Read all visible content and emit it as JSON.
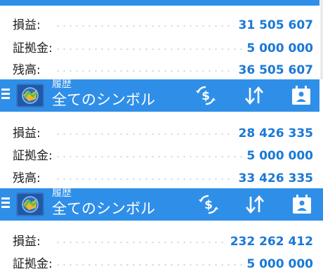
{
  "colors": {
    "toolbar": "#2f8fe8",
    "value": "#1a78d6",
    "label": "#1e1e1e"
  },
  "block1": {
    "rows": [
      {
        "label": "損益:",
        "value": "31 505 607"
      },
      {
        "label": "証拠金:",
        "value": "5 000 000"
      },
      {
        "label": "残高:",
        "value": "36 505 607"
      }
    ]
  },
  "toolbar1": {
    "subtitle": "履歴",
    "title": "全てのシンボル",
    "icons": [
      "menu-icon",
      "app-logo-icon",
      "currency-exchange-icon",
      "sort-icon",
      "calendar-icon"
    ]
  },
  "block2": {
    "rows": [
      {
        "label": "損益:",
        "value": "28 426 335"
      },
      {
        "label": "証拠金:",
        "value": "5 000 000"
      },
      {
        "label": "残高:",
        "value": "33 426 335"
      }
    ]
  },
  "toolbar2": {
    "subtitle": "履歴",
    "title": "全てのシンボル",
    "icons": [
      "menu-icon",
      "app-logo-icon",
      "currency-exchange-icon",
      "sort-icon",
      "calendar-icon"
    ]
  },
  "block3": {
    "rows": [
      {
        "label": "損益:",
        "value": "232 262 412"
      },
      {
        "label": "証拠金:",
        "value": "5 000 000"
      }
    ]
  }
}
